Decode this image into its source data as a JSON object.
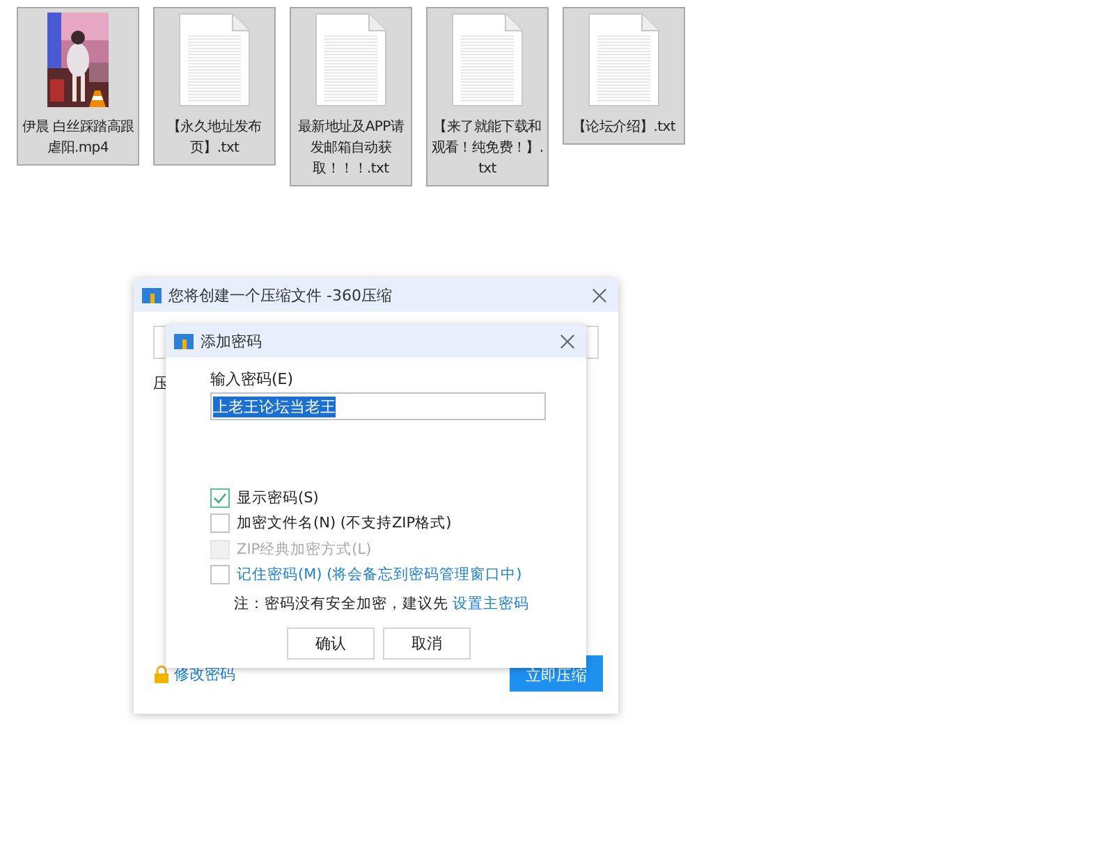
{
  "files": [
    {
      "name": "伊晨 白丝踩踏高跟虐阳.mp4",
      "kind": "video",
      "selected": true
    },
    {
      "name": "【永久地址发布页】.txt",
      "kind": "text",
      "selected": true
    },
    {
      "name": "最新地址及APP请发邮箱自动获取！！！.txt",
      "kind": "text",
      "selected": true
    },
    {
      "name": "【来了就能下载和观看！纯免费！】.txt",
      "kind": "text",
      "selected": true
    },
    {
      "name": "【论坛介绍】.txt",
      "kind": "text",
      "selected": true
    }
  ],
  "main_window": {
    "title": "您将创建一个压缩文件 -360压缩",
    "label": "压",
    "change_password_link": "修改密码",
    "compress_button": "立即压缩"
  },
  "dialog": {
    "title": "添加密码",
    "password_label": "输入密码(E)",
    "password_value": "上老王论坛当老王",
    "options": [
      {
        "label": "显示密码(S)",
        "kind": "plain",
        "checked": true,
        "disabled": false
      },
      {
        "label": "加密文件名(N) (不支持ZIP格式)",
        "kind": "plain",
        "checked": false,
        "disabled": false
      },
      {
        "label": "ZIP经典加密方式(L)",
        "kind": "plain",
        "checked": false,
        "disabled": true
      },
      {
        "label": "记住密码(M) (将会备忘到密码管理窗口中)",
        "kind": "link",
        "checked": false,
        "disabled": false
      }
    ],
    "note": "注：密码没有安全加密，建议先",
    "note_link": "设置主密码",
    "buttons": [
      "确认",
      "取消"
    ]
  }
}
